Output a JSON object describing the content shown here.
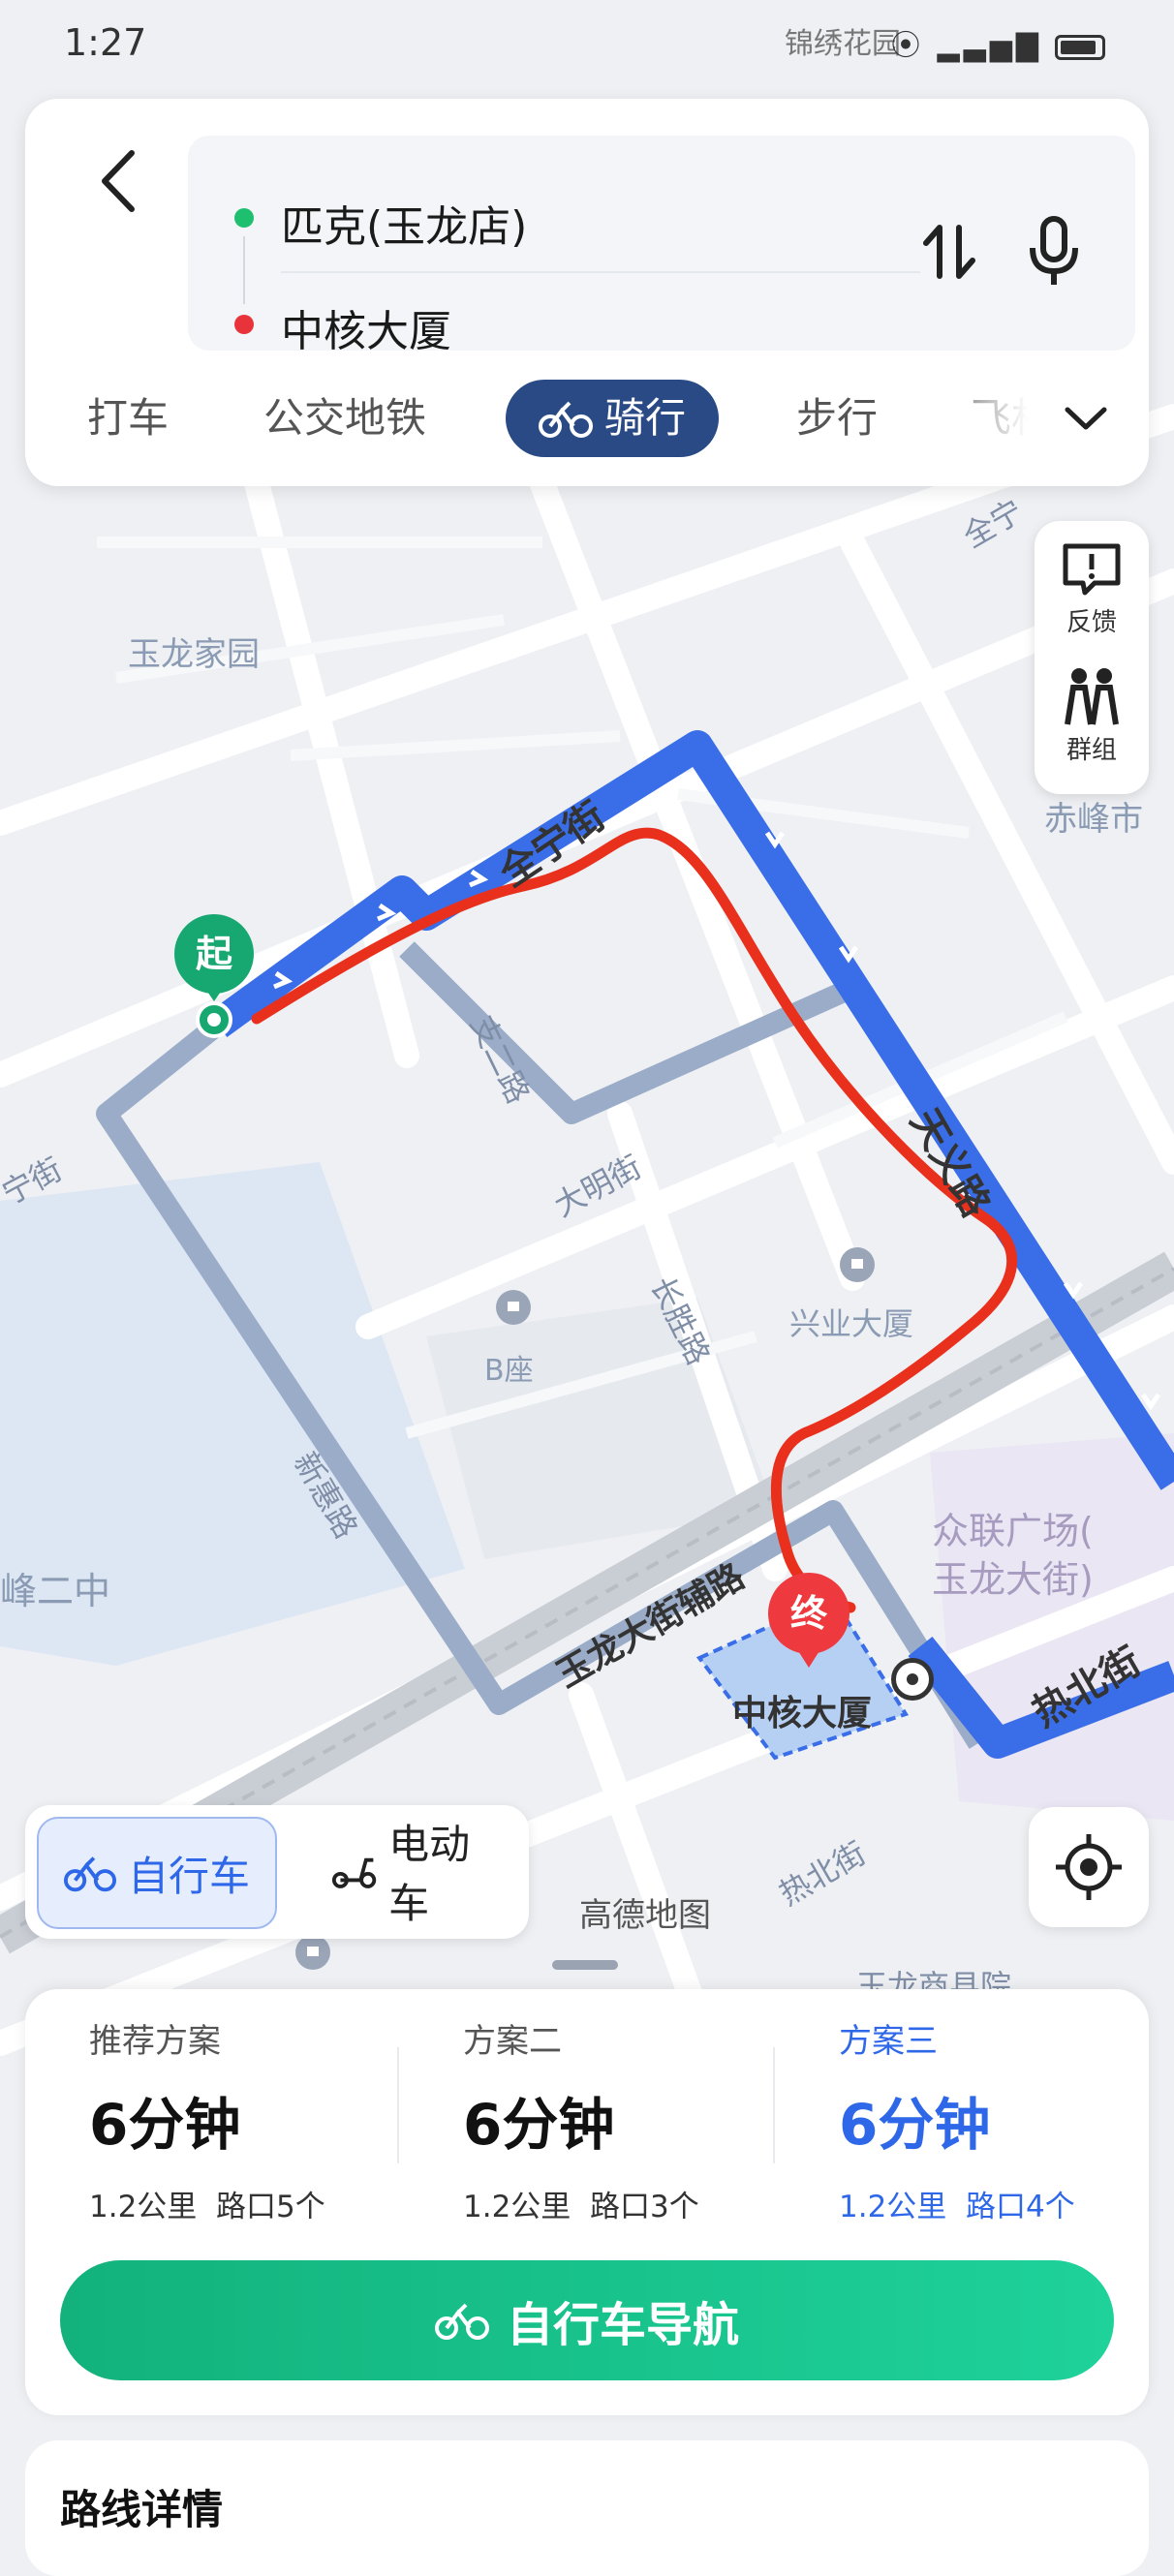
{
  "status_bar": {
    "time": "1:27",
    "map_text": "锦绣花园"
  },
  "route": {
    "start": "匹克(玉龙店)",
    "end": "中核大厦"
  },
  "modes": [
    {
      "label": "打车"
    },
    {
      "label": "公交地铁"
    },
    {
      "label": "骑行",
      "active": true
    },
    {
      "label": "步行"
    },
    {
      "label": "飞机"
    }
  ],
  "tools": {
    "feedback": "反馈",
    "group": "群组"
  },
  "map": {
    "places": [
      "玉龙家园",
      "赤峰市",
      "B座",
      "兴业大厦",
      "众联广场(",
      "玉龙大街)",
      "峰二中",
      "宁街",
      "玉龙商县院"
    ],
    "roads": [
      "全宁街",
      "天义路",
      "支二路",
      "大明街",
      "长胜路",
      "新惠路",
      "玉龙大街辅路",
      "热北街",
      "热北街",
      "全宁"
    ],
    "start_marker": "起",
    "end_marker": "终",
    "end_label": "中核大厦",
    "attribution": "高德地图"
  },
  "vehicle": {
    "bike": "自行车",
    "ebike": "电动车"
  },
  "plans": [
    {
      "name": "推荐方案",
      "time": "6分钟",
      "distance": "1.2公里",
      "junctions": "路口5个"
    },
    {
      "name": "方案二",
      "time": "6分钟",
      "distance": "1.2公里",
      "junctions": "路口3个"
    },
    {
      "name": "方案三",
      "time": "6分钟",
      "distance": "1.2公里",
      "junctions": "路口4个",
      "selected": true
    }
  ],
  "nav_button": "自行车导航",
  "details_title": "路线详情",
  "colors": {
    "route_blue": "#3a6ee8",
    "accent_green": "#1ec98f",
    "annotation_red": "#e8301c",
    "tab_active": "#2a4a86"
  }
}
